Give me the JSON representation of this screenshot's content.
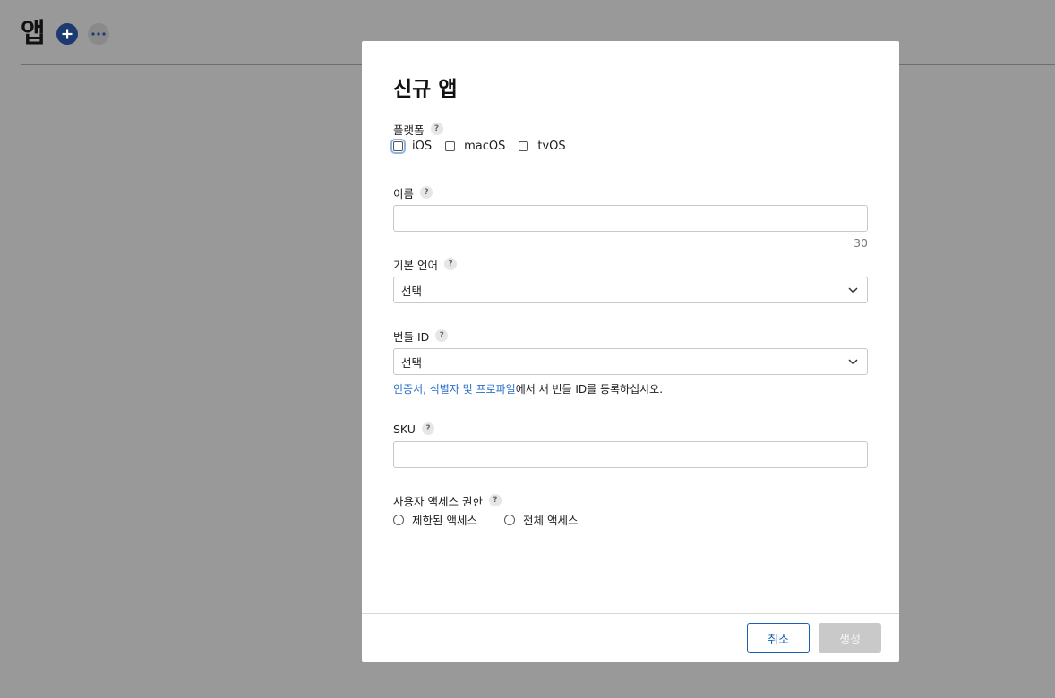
{
  "page": {
    "title": "앱",
    "add_icon": "plus-circle-icon",
    "more_icon": "ellipsis-icon"
  },
  "modal": {
    "title": "신규 앱",
    "platform": {
      "label": "플랫폼",
      "help": "?",
      "options": [
        "iOS",
        "macOS",
        "tvOS"
      ]
    },
    "name": {
      "label": "이름",
      "help": "?",
      "value": "",
      "counter": "30"
    },
    "language": {
      "label": "기본 언어",
      "help": "?",
      "selected": "선택"
    },
    "bundle": {
      "label": "번들 ID",
      "help": "?",
      "selected": "선택",
      "helper_link": "인증서, 식별자 및 프로파일",
      "helper_text": "에서 새 번들 ID를 등록하십시오."
    },
    "sku": {
      "label": "SKU",
      "help": "?",
      "value": ""
    },
    "access": {
      "label": "사용자 액세스 권한",
      "help": "?",
      "options": [
        "제한된 액세스",
        "전체 액세스"
      ]
    },
    "footer": {
      "cancel": "취소",
      "create": "생성"
    }
  },
  "colors": {
    "overlay": "#999999",
    "accent": "#1a5fb4",
    "link": "#2a6fc9",
    "disabled_button": "#c9c9c9"
  }
}
